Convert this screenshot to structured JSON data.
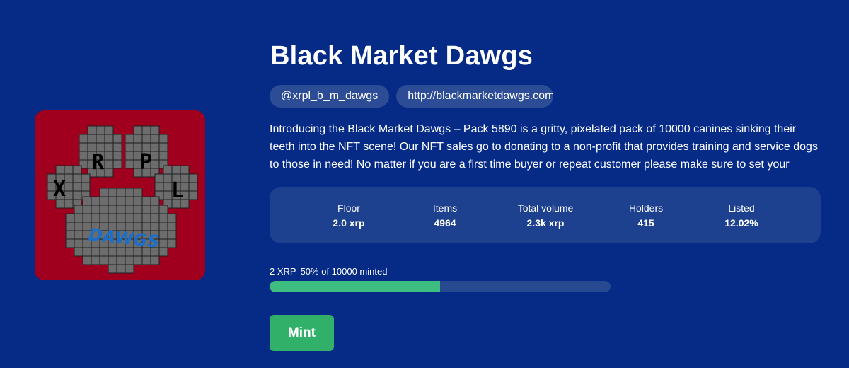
{
  "collection": {
    "name": "Black Market Dawgs",
    "handle": "@xrpl_b_m_dawgs",
    "website": "http://blackmarketdawgs.com",
    "description": "Introducing the Black Market Dawgs – Pack 5890 is a gritty, pixelated pack of 10000 canines sinking their teeth into the NFT scene! Our NFT sales go to donating to a non-profit that provides training and service dogs to those in need! No matter if you are a first time buyer or repeat customer please make sure to set your"
  },
  "logo": {
    "letters": [
      "R",
      "P",
      "X",
      "L"
    ],
    "text": "DAWGS",
    "colors": {
      "background": "#a0001e",
      "pixel": "#6c6c6c",
      "grid": "#1e1e1e",
      "text": "#1c6fc8"
    }
  },
  "stats": [
    {
      "label": "Floor",
      "value": "2.0 xrp"
    },
    {
      "label": "Items",
      "value": "4964"
    },
    {
      "label": "Total volume",
      "value": "2.3k xrp"
    },
    {
      "label": "Holders",
      "value": "415"
    },
    {
      "label": "Listed",
      "value": "12.02%"
    }
  ],
  "mint": {
    "price": "2 XRP",
    "progress_text": "50% of 10000 minted",
    "progress_fraction": 0.5,
    "button_label": "Mint"
  },
  "colors": {
    "page_background": "#052b87",
    "accent_green": "#30b069",
    "progress_fill": "#3dbd80"
  }
}
